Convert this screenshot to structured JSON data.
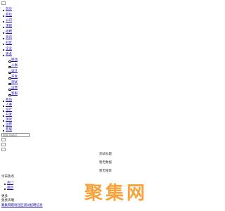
{
  "header": {
    "logo_alt": "logo"
  },
  "nav": {
    "items": [
      {
        "label": "首页"
      },
      {
        "label": "职位"
      },
      {
        "label": "公司"
      },
      {
        "label": "求职"
      },
      {
        "label": "招聘"
      },
      {
        "label": "资讯"
      },
      {
        "label": "社区"
      },
      {
        "label": "企业"
      },
      {
        "label": "更多"
      }
    ],
    "submenu": [
      {
        "label": "移动"
      },
      {
        "label": "人事"
      },
      {
        "label": "设计"
      },
      {
        "label": "开发"
      },
      {
        "label": "测试"
      },
      {
        "label": "运营"
      },
      {
        "label": "客服"
      },
      {
        "label": "其他"
      }
    ],
    "items2": [
      {
        "label": "移动"
      },
      {
        "label": "人事"
      },
      {
        "label": "设计"
      },
      {
        "label": "开发"
      },
      {
        "label": "测试"
      },
      {
        "label": "运营"
      },
      {
        "label": "客服"
      },
      {
        "label": "其他"
      }
    ]
  },
  "search": {
    "placeholder": "搜索关键词"
  },
  "main": {
    "lines": [
      "测试标题",
      "暂无数据",
      "暂无推荐"
    ]
  },
  "sidebar": {
    "title": "今日热点",
    "items": [
      {
        "label": "热门"
      },
      {
        "label": "最新"
      }
    ]
  },
  "brand": {
    "text": "聚集网"
  },
  "footer": {
    "line1": "更多",
    "line2": "免责声明",
    "link": "聚集网职场社区测试招聘信息"
  }
}
